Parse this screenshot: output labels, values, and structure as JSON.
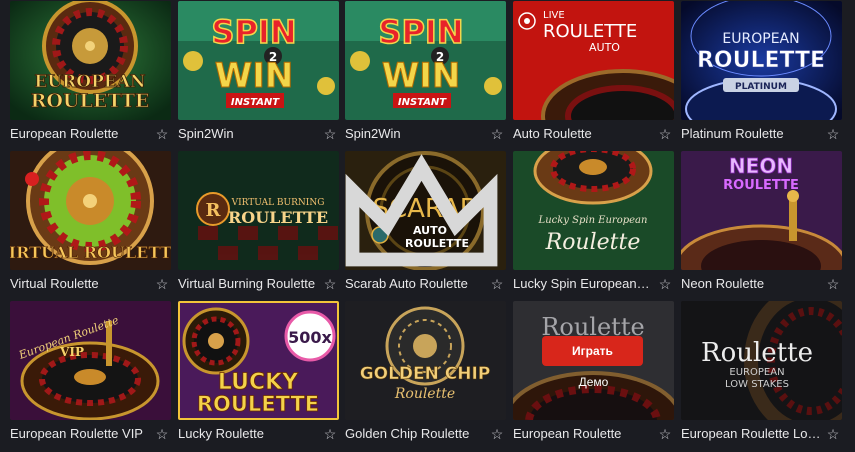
{
  "colors": {
    "page_bg": "#1b1c22",
    "title_text": "#e8e8ea",
    "play_button": "#d8261b"
  },
  "favorite_icon": "star-outline-icon",
  "games": [
    {
      "id": "european-roulette-1",
      "title": "European Roulette",
      "art": [
        "EUROPEAN",
        "ROULETTE"
      ]
    },
    {
      "id": "spin2win-1",
      "title": "Spin2Win",
      "art": [
        "SPIN",
        "WIN",
        "INSTANT"
      ]
    },
    {
      "id": "spin2win-2",
      "title": "Spin2Win",
      "art": [
        "SPIN",
        "WIN",
        "INSTANT"
      ]
    },
    {
      "id": "auto-roulette",
      "title": "Auto Roulette",
      "art": [
        "LIVE",
        "ROULETTE",
        "AUTO"
      ]
    },
    {
      "id": "platinum-roulette",
      "title": "Platinum Roulette",
      "art": [
        "EUROPEAN",
        "ROULETTE",
        "PLATINUM"
      ]
    },
    {
      "id": "virtual-roulette",
      "title": "Virtual Roulette",
      "art": [
        "VIRTUAL ROULETTE"
      ]
    },
    {
      "id": "virtual-burning-roulette",
      "title": "Virtual Burning Roulette",
      "art": [
        "VIRTUAL BURNING",
        "ROULETTE"
      ]
    },
    {
      "id": "scarab-auto-roulette",
      "title": "Scarab Auto Roulette",
      "art": [
        "SCARAB",
        "AUTO",
        "ROULETTE"
      ],
      "badge": "crown-icon"
    },
    {
      "id": "lucky-spin-european-roulette",
      "title": "Lucky Spin European R...",
      "art": [
        "Lucky Spin European",
        "Roulette"
      ]
    },
    {
      "id": "neon-roulette",
      "title": "Neon Roulette",
      "art": [
        "NEON",
        "ROULETTE"
      ]
    },
    {
      "id": "european-roulette-vip",
      "title": "European Roulette VIP",
      "art": [
        "European Roulette",
        "VIP"
      ]
    },
    {
      "id": "lucky-roulette",
      "title": "Lucky Roulette",
      "art": [
        "500x",
        "LUCKY",
        "ROULETTE"
      ]
    },
    {
      "id": "golden-chip-roulette",
      "title": "Golden Chip Roulette",
      "art": [
        "GOLDEN CHIP",
        "Roulette"
      ]
    },
    {
      "id": "european-roulette-2",
      "title": "European Roulette",
      "art": [
        "Roulette"
      ],
      "hover": {
        "play_label": "Играть",
        "demo_label": "Демо"
      }
    },
    {
      "id": "european-roulette-low-stakes",
      "title": "European Roulette Low ...",
      "art": [
        "Roulette",
        "EUROPEAN",
        "LOW STAKES"
      ]
    }
  ]
}
